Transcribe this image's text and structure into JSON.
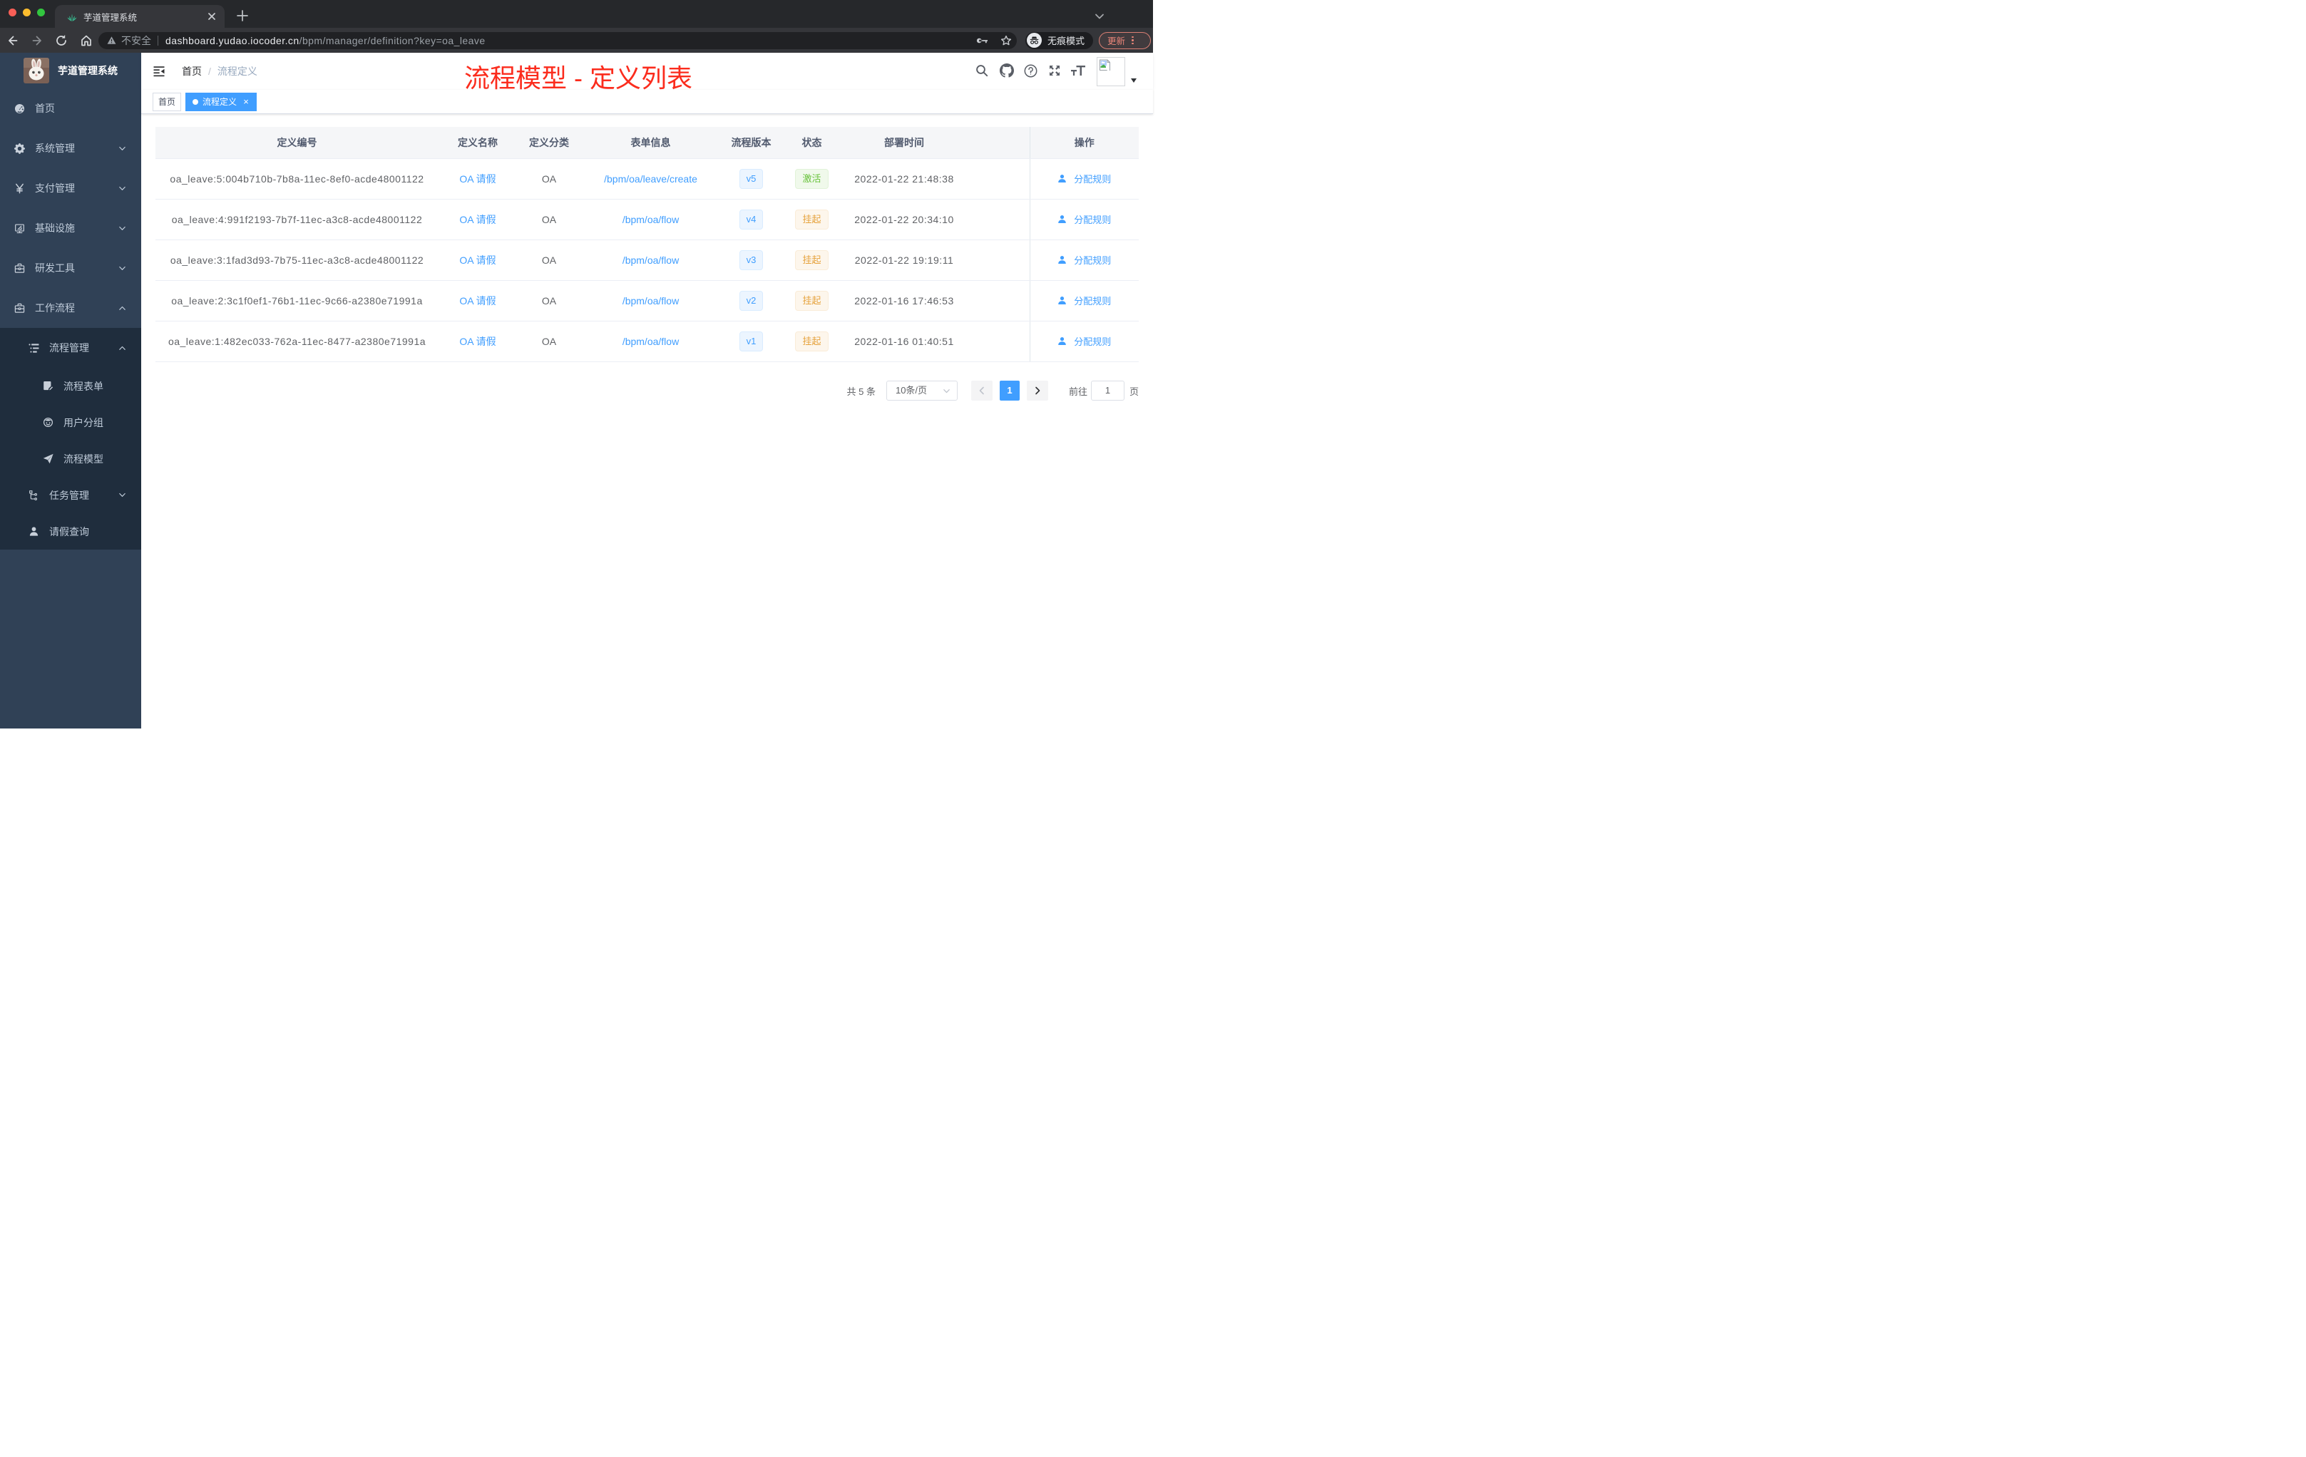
{
  "browser": {
    "tab_title": "芋道管理系统",
    "url": {
      "security_label": "不安全",
      "host": "dashboard.yudao.iocoder.cn",
      "path": "/bpm/manager/definition?key=oa_leave"
    },
    "incognito_label": "无痕模式",
    "update_label": "更新"
  },
  "sidebar": {
    "logo_title": "芋道管理系统",
    "menu": [
      {
        "icon": "dashboard-icon",
        "label": "首页",
        "level": 1,
        "arrow": "",
        "group": "light"
      },
      {
        "icon": "gear-icon",
        "label": "系统管理",
        "level": 1,
        "arrow": "down",
        "group": "light"
      },
      {
        "icon": "yen-icon",
        "label": "支付管理",
        "level": 1,
        "arrow": "down",
        "group": "light"
      },
      {
        "icon": "infra-icon",
        "label": "基础设施",
        "level": 1,
        "arrow": "down",
        "group": "light"
      },
      {
        "icon": "toolbox-icon",
        "label": "研发工具",
        "level": 1,
        "arrow": "down",
        "group": "light"
      },
      {
        "icon": "briefcase-icon",
        "label": "工作流程",
        "level": 1,
        "arrow": "up",
        "group": "light"
      },
      {
        "icon": "tree-list-icon",
        "label": "流程管理",
        "level": 2,
        "arrow": "up",
        "group": "dark"
      },
      {
        "icon": "form-icon",
        "label": "流程表单",
        "level": 3,
        "arrow": "",
        "group": "dark"
      },
      {
        "icon": "user-group-icon",
        "label": "用户分组",
        "level": 3,
        "arrow": "",
        "group": "dark"
      },
      {
        "icon": "paper-plane-icon",
        "label": "流程模型",
        "level": 3,
        "arrow": "",
        "group": "dark"
      },
      {
        "icon": "flow-tree-icon",
        "label": "任务管理",
        "level": 2,
        "arrow": "down",
        "group": "dark"
      },
      {
        "icon": "user-icon",
        "label": "请假查询",
        "level": 2,
        "arrow": "",
        "group": "dark"
      }
    ]
  },
  "navbar": {
    "breadcrumb": {
      "home": "首页",
      "separator": "/",
      "current": "流程定义"
    },
    "annotation": "流程模型 - 定义列表"
  },
  "tags": [
    {
      "label": "首页",
      "active": false,
      "closable": false
    },
    {
      "label": "流程定义",
      "active": true,
      "closable": true
    }
  ],
  "table": {
    "columns": [
      "定义编号",
      "定义名称",
      "定义分类",
      "表单信息",
      "流程版本",
      "状态",
      "部署时间",
      "操作"
    ],
    "action_label": "分配规则",
    "rows": [
      {
        "id": "oa_leave:5:004b710b-7b8a-11ec-8ef0-acde48001122",
        "name": "OA 请假",
        "category": "OA",
        "form": "/bpm/oa/leave/create",
        "version": "v5",
        "status": "激活",
        "status_type": "success",
        "time": "2022-01-22 21:48:38"
      },
      {
        "id": "oa_leave:4:991f2193-7b7f-11ec-a3c8-acde48001122",
        "name": "OA 请假",
        "category": "OA",
        "form": "/bpm/oa/flow",
        "version": "v4",
        "status": "挂起",
        "status_type": "warning",
        "time": "2022-01-22 20:34:10"
      },
      {
        "id": "oa_leave:3:1fad3d93-7b75-11ec-a3c8-acde48001122",
        "name": "OA 请假",
        "category": "OA",
        "form": "/bpm/oa/flow",
        "version": "v3",
        "status": "挂起",
        "status_type": "warning",
        "time": "2022-01-22 19:19:11"
      },
      {
        "id": "oa_leave:2:3c1f0ef1-76b1-11ec-9c66-a2380e71991a",
        "name": "OA 请假",
        "category": "OA",
        "form": "/bpm/oa/flow",
        "version": "v2",
        "status": "挂起",
        "status_type": "warning",
        "time": "2022-01-16 17:46:53"
      },
      {
        "id": "oa_leave:1:482ec033-762a-11ec-8477-a2380e71991a",
        "name": "OA 请假",
        "category": "OA",
        "form": "/bpm/oa/flow",
        "version": "v1",
        "status": "挂起",
        "status_type": "warning",
        "time": "2022-01-16 01:40:51"
      }
    ]
  },
  "pagination": {
    "total": "共 5 条",
    "page_size": "10条/页",
    "current_page": "1",
    "goto_label": "前往",
    "goto_value": "1",
    "page_unit": "页"
  }
}
